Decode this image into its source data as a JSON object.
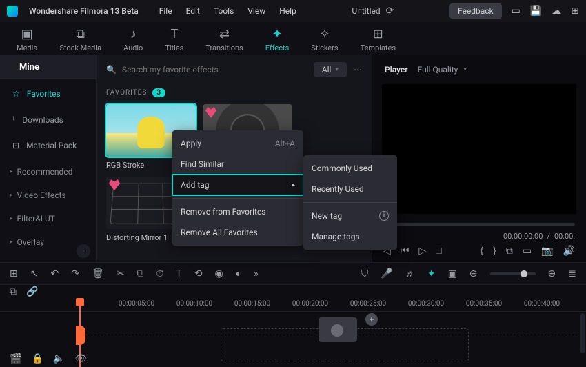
{
  "app": {
    "title": "Wondershare Filmora 13 Beta"
  },
  "menu": {
    "file": "File",
    "edit": "Edit",
    "tools": "Tools",
    "view": "View",
    "help": "Help"
  },
  "doc": {
    "title": "Untitled"
  },
  "feedback": {
    "label": "Feedback"
  },
  "media_tabs": {
    "media": "Media",
    "stock": "Stock Media",
    "audio": "Audio",
    "titles": "Titles",
    "transitions": "Transitions",
    "effects": "Effects",
    "stickers": "Stickers",
    "templates": "Templates"
  },
  "sidebar": {
    "mine": "Mine",
    "favorites": "Favorites",
    "downloads": "Downloads",
    "material_pack": "Material Pack",
    "recommended": "Recommended",
    "video_effects": "Video Effects",
    "filter_lut": "Filter&LUT",
    "overlay": "Overlay"
  },
  "search": {
    "placeholder": "Search my favorite effects"
  },
  "filter": {
    "label": "All"
  },
  "favorites": {
    "header": "FAVORITES",
    "count": "3"
  },
  "items": {
    "rgb_stroke": "RGB Stroke",
    "distorting": "Distorting Mirror 1"
  },
  "ctx": {
    "apply": "Apply",
    "apply_accel": "Alt+A",
    "find_similar": "Find Similar",
    "add_tag": "Add tag",
    "remove_fav": "Remove from Favorites",
    "remove_all": "Remove All Favorites"
  },
  "submenu": {
    "commonly": "Commonly Used",
    "recently": "Recently Used",
    "new_tag": "New tag",
    "manage": "Manage tags"
  },
  "preview": {
    "player": "Player",
    "quality": "Full Quality"
  },
  "time": {
    "current": "00:00:00:00",
    "sep": "/",
    "total": "00:00:"
  },
  "ruler": {
    "t0": "00:00:05:00",
    "t1": "00:00:10:00",
    "t2": "00:00:15:00",
    "t3": "00:00:20:00",
    "t4": "00:00:25:00",
    "t5": "00:00:30:00",
    "t6": "00:00:35:00",
    "t7": "00:00:40:00"
  }
}
